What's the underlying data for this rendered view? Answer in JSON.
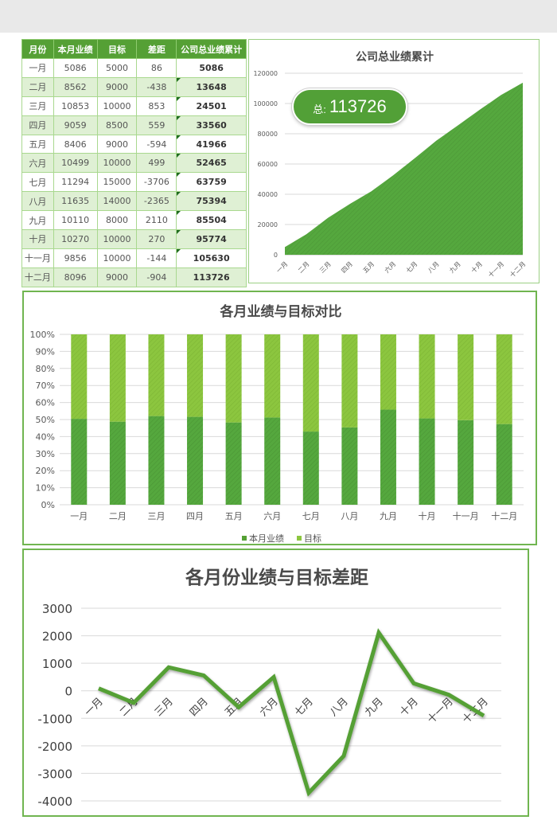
{
  "table": {
    "headers": [
      "月份",
      "本月业绩",
      "目标",
      "差距",
      "公司总业绩累计"
    ],
    "rows": [
      [
        "一月",
        "5086",
        "5000",
        "86",
        "5086"
      ],
      [
        "二月",
        "8562",
        "9000",
        "-438",
        "13648"
      ],
      [
        "三月",
        "10853",
        "10000",
        "853",
        "24501"
      ],
      [
        "四月",
        "9059",
        "8500",
        "559",
        "33560"
      ],
      [
        "五月",
        "8406",
        "9000",
        "-594",
        "41966"
      ],
      [
        "六月",
        "10499",
        "10000",
        "499",
        "52465"
      ],
      [
        "七月",
        "11294",
        "15000",
        "-3706",
        "63759"
      ],
      [
        "八月",
        "11635",
        "14000",
        "-2365",
        "75394"
      ],
      [
        "九月",
        "10110",
        "8000",
        "2110",
        "85504"
      ],
      [
        "十月",
        "10270",
        "10000",
        "270",
        "95774"
      ],
      [
        "十一月",
        "9856",
        "10000",
        "-144",
        "105630"
      ],
      [
        "十二月",
        "8096",
        "9000",
        "-904",
        "113726"
      ]
    ]
  },
  "badge": {
    "label": "总:",
    "value": "113726"
  },
  "colors": {
    "primary": "#55a035",
    "secondary": "#8cc63f",
    "light_row": "#dff0d4",
    "grid": "#d9d9d9"
  },
  "chart_data": [
    {
      "type": "area",
      "title": "公司总业绩累计",
      "categories": [
        "一月",
        "二月",
        "三月",
        "四月",
        "五月",
        "六月",
        "七月",
        "八月",
        "九月",
        "十月",
        "十一月",
        "十二月"
      ],
      "values": [
        5086,
        13648,
        24501,
        33560,
        41966,
        52465,
        63759,
        75394,
        85504,
        95774,
        105630,
        113726
      ],
      "ylim": [
        0,
        120000
      ],
      "yticks": [
        "0",
        "20000",
        "40000",
        "60000",
        "80000",
        "100000",
        "120000"
      ],
      "ytick_values": [
        0,
        20000,
        40000,
        60000,
        80000,
        100000,
        120000
      ],
      "grid": true,
      "xlabel": "",
      "ylabel": ""
    },
    {
      "type": "bar",
      "stacked": "percent",
      "title": "各月业绩与目标对比",
      "categories": [
        "一月",
        "二月",
        "三月",
        "四月",
        "五月",
        "六月",
        "七月",
        "八月",
        "九月",
        "十月",
        "十一月",
        "十二月"
      ],
      "series": [
        {
          "name": "本月业绩",
          "values": [
            5086,
            8562,
            10853,
            9059,
            8406,
            10499,
            11294,
            11635,
            10110,
            10270,
            9856,
            8096
          ]
        },
        {
          "name": "目标",
          "values": [
            5000,
            9000,
            10000,
            8500,
            9000,
            10000,
            15000,
            14000,
            8000,
            10000,
            10000,
            9000
          ]
        }
      ],
      "ylim": [
        0,
        1
      ],
      "yticks": [
        "0%",
        "10%",
        "20%",
        "30%",
        "40%",
        "50%",
        "60%",
        "70%",
        "80%",
        "90%",
        "100%"
      ],
      "legend": "bottom",
      "grid": true,
      "xlabel": "",
      "ylabel": ""
    },
    {
      "type": "line",
      "title": "各月份业绩与目标差距",
      "categories": [
        "一月",
        "二月",
        "三月",
        "四月",
        "五月",
        "六月",
        "七月",
        "八月",
        "九月",
        "十月",
        "十一月",
        "十二月"
      ],
      "values": [
        86,
        -438,
        853,
        559,
        -594,
        499,
        -3706,
        -2365,
        2110,
        270,
        -144,
        -904
      ],
      "ylim": [
        -4000,
        3000
      ],
      "yticks": [
        "-4000",
        "-3000",
        "-2000",
        "-1000",
        "0",
        "1000",
        "2000",
        "3000"
      ],
      "ytick_values": [
        -4000,
        -3000,
        -2000,
        -1000,
        0,
        1000,
        2000,
        3000
      ],
      "grid": true,
      "xlabel": "",
      "ylabel": ""
    }
  ]
}
